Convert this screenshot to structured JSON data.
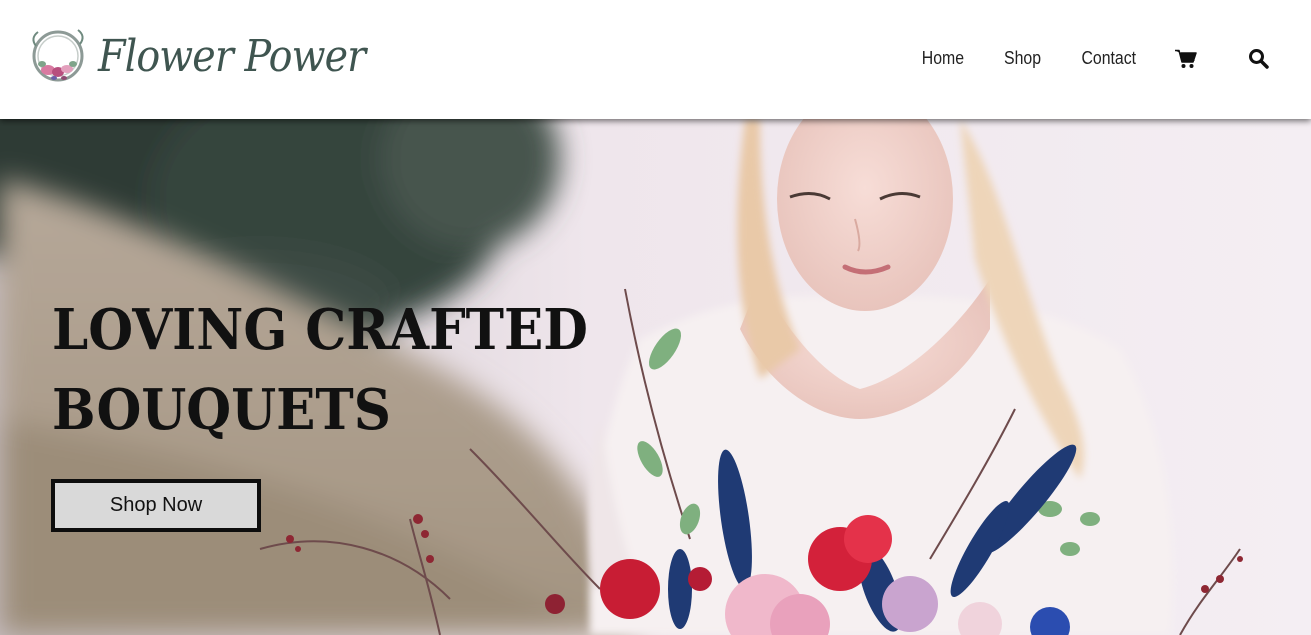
{
  "brand": {
    "name": "Flower Power",
    "logo_icon": "floral-wreath-icon",
    "text_color": "#3f5550"
  },
  "nav": {
    "items": [
      {
        "label": "Home"
      },
      {
        "label": "Shop"
      },
      {
        "label": "Contact"
      }
    ],
    "cart_icon": "shopping-cart-icon",
    "search_icon": "search-icon"
  },
  "hero": {
    "title_line1": "LOVING CRAFTED",
    "title_line2": "BOUQUETS",
    "cta_label": "Shop Now",
    "image_subject": "woman in white lace dress holding a wildflower bouquet"
  },
  "colors": {
    "header_bg": "#ffffff",
    "cta_bg": "#d9d9d9",
    "cta_border": "#0d0d0d",
    "title_color": "#111111"
  }
}
